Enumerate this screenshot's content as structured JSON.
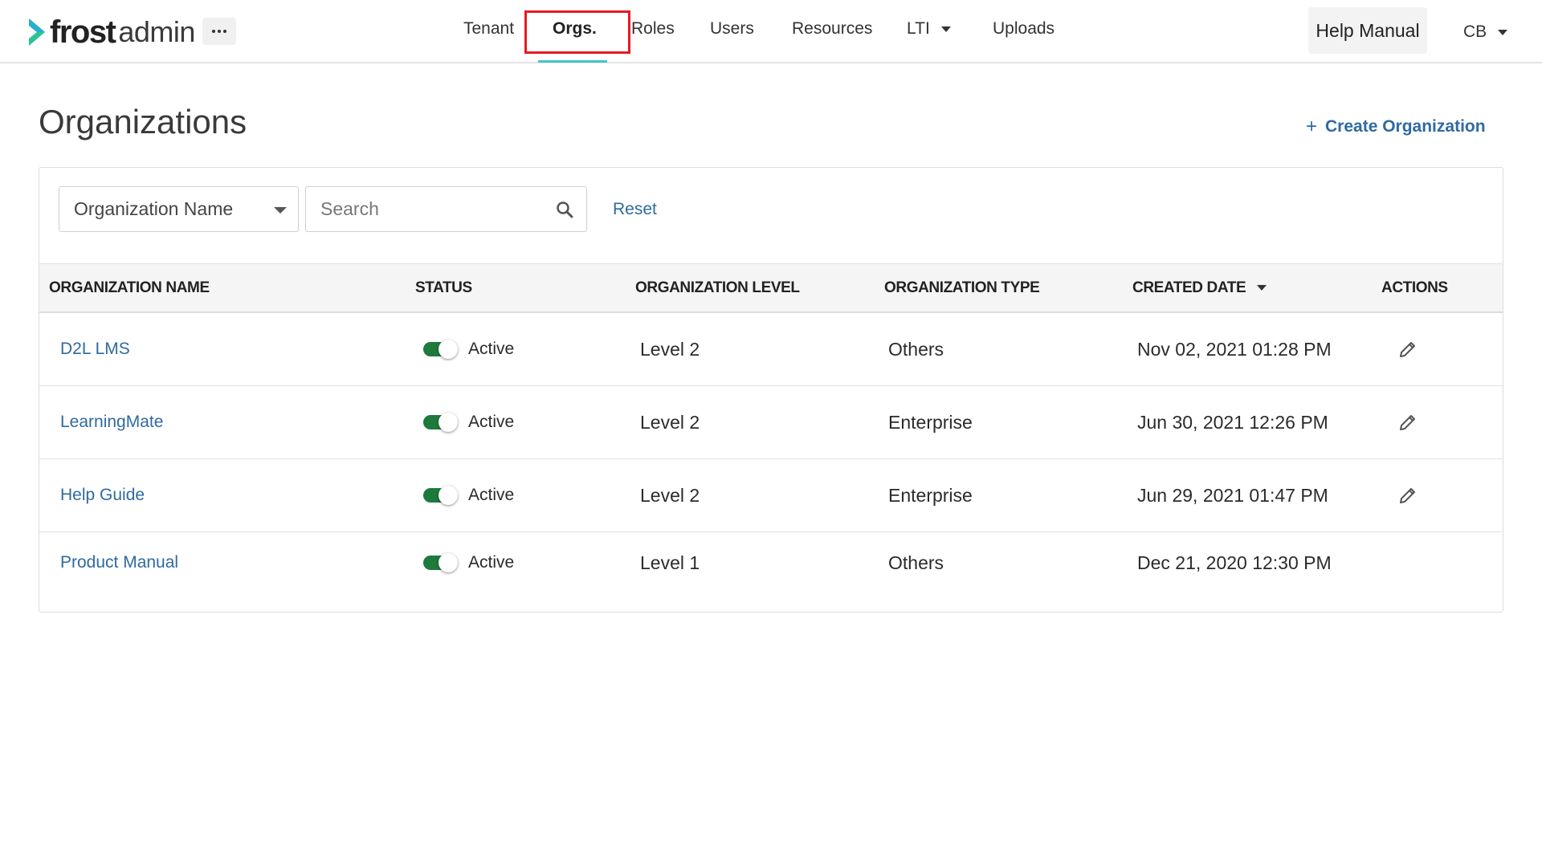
{
  "header": {
    "logo_word": "frost",
    "logo_sub": "admin",
    "nav": [
      {
        "label": "Tenant"
      },
      {
        "label": "Orgs."
      },
      {
        "label": "Roles"
      },
      {
        "label": "Users"
      },
      {
        "label": "Resources"
      },
      {
        "label": "LTI"
      },
      {
        "label": "Uploads"
      }
    ],
    "help_label": "Help Manual",
    "user_initials": "CB"
  },
  "page": {
    "title": "Organizations",
    "create_label": "Create Organization"
  },
  "filters": {
    "field_selected": "Organization Name",
    "search_placeholder": "Search",
    "reset_label": "Reset"
  },
  "table": {
    "columns": [
      "ORGANIZATION NAME",
      "STATUS",
      "ORGANIZATION LEVEL",
      "ORGANIZATION TYPE",
      "CREATED DATE",
      "ACTIONS"
    ],
    "rows": [
      {
        "name": "D2L LMS",
        "status": "Active",
        "level": "Level 2",
        "type": "Others",
        "created": "Nov 02, 2021 01:28 PM",
        "editable": true
      },
      {
        "name": "LearningMate",
        "status": "Active",
        "level": "Level 2",
        "type": "Enterprise",
        "created": "Jun 30, 2021 12:26 PM",
        "editable": true
      },
      {
        "name": "Help Guide",
        "status": "Active",
        "level": "Level 2",
        "type": "Enterprise",
        "created": "Jun 29, 2021 01:47 PM",
        "editable": true
      },
      {
        "name": "Product Manual",
        "status": "Active",
        "level": "Level 1",
        "type": "Others",
        "created": "Dec 21, 2020 12:30 PM",
        "editable": false
      }
    ]
  },
  "colors": {
    "accent_teal": "#43c6c9",
    "link_blue": "#2f6aa0",
    "toggle_green": "#1d7a3c",
    "highlight_red": "#e31b23"
  },
  "icons": {
    "more": "more-horizontal-icon",
    "search": "search-icon",
    "edit": "pencil-icon",
    "sort": "sort-descending-icon"
  }
}
